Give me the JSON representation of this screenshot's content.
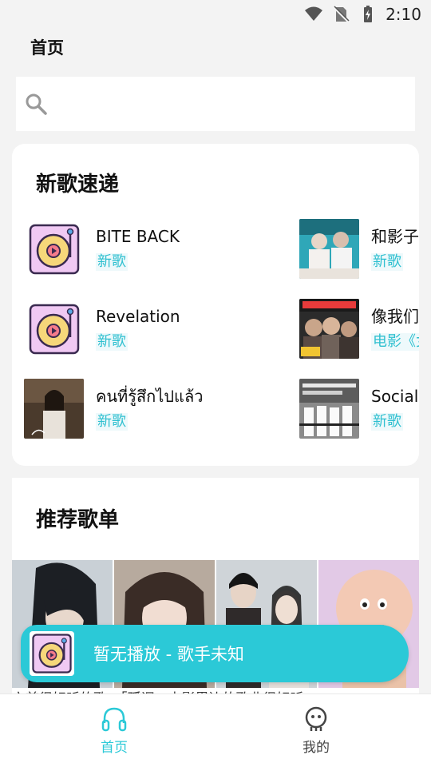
{
  "status_bar": {
    "time": "2:10",
    "icons": [
      "wifi-icon",
      "no-sim-icon",
      "battery-charging-icon"
    ]
  },
  "header": {
    "title": "首页"
  },
  "search": {
    "placeholder": "",
    "icon": "search-icon"
  },
  "new_songs": {
    "title": "新歌速递",
    "items": [
      {
        "name": "BITE BACK",
        "tag": "新歌",
        "cover": "vinyl-placeholder"
      },
      {
        "name": "和影子",
        "tag": "新歌",
        "cover": "album-photo"
      },
      {
        "name": "Revelation",
        "tag": "新歌",
        "cover": "vinyl-placeholder"
      },
      {
        "name": "像我们",
        "tag": "电影《女",
        "cover": "album-photo"
      },
      {
        "name": "คนที่รู้สึกไปแล้ว",
        "tag": "新歌",
        "cover": "album-photo"
      },
      {
        "name": "Social",
        "tag": "新歌",
        "cover": "album-photo"
      }
    ]
  },
  "recommended": {
    "title": "推荐歌单",
    "playlists": [
      "playlist-1",
      "playlist-2",
      "playlist-3",
      "playlist-4"
    ],
    "description": "六首很好听的歌，「孤调」电影里边的歌曲很好听，"
  },
  "player": {
    "text": "暂无播放 - 歌手未知",
    "color": "#2bc9d7"
  },
  "tabs": [
    {
      "label": "首页",
      "icon": "headphones-icon",
      "active": true
    },
    {
      "label": "我的",
      "icon": "face-icon",
      "active": false
    }
  ],
  "colors": {
    "accent": "#2bc9d7",
    "tag_text": "#2fc0d0"
  }
}
